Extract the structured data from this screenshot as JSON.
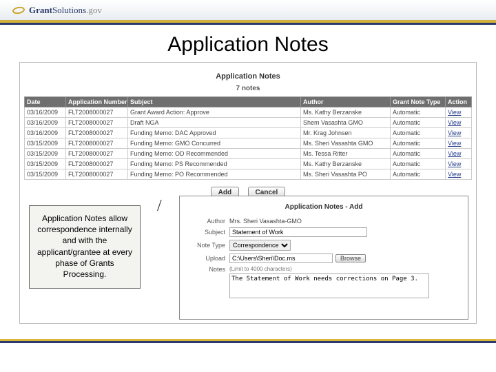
{
  "brand": {
    "name_bold": "Grant",
    "name_rest": "Solutions",
    "suffix": ".gov"
  },
  "slide_title": "Application Notes",
  "panel": {
    "title": "Application Notes",
    "count_label": "7 notes"
  },
  "columns": {
    "date": "Date",
    "appnum": "Application Number",
    "subject": "Subject",
    "author": "Author",
    "type": "Grant Note Type",
    "action": "Action"
  },
  "rows": [
    {
      "date": "03/16/2009",
      "appnum": "FLT2008000027",
      "subject": "Grant Award Action: Approve",
      "author": "Ms. Kathy Berzanske",
      "type": "Automatic",
      "action": "View"
    },
    {
      "date": "03/16/2009",
      "appnum": "FLT2008000027",
      "subject": "Draft NGA",
      "author": "Shem Vasashta GMO",
      "type": "Automatic",
      "action": "View"
    },
    {
      "date": "03/16/2009",
      "appnum": "FLT2008000027",
      "subject": "Funding Memo: DAC Approved",
      "author": "Mr. Krag Johnsen",
      "type": "Automatic",
      "action": "View"
    },
    {
      "date": "03/15/2009",
      "appnum": "FLT2008000027",
      "subject": "Funding Memo: GMO Concurred",
      "author": "Ms. Sheri Vasashta GMO",
      "type": "Automatic",
      "action": "View"
    },
    {
      "date": "03/15/2009",
      "appnum": "FLT2008000027",
      "subject": "Funding Memo: OD Recommended",
      "author": "Ms. Tessa Ritter",
      "type": "Automatic",
      "action": "View"
    },
    {
      "date": "03/15/2009",
      "appnum": "FLT2008000027",
      "subject": "Funding Memo: PS Recommended",
      "author": "Ms. Kathy Berzanske",
      "type": "Automatic",
      "action": "View"
    },
    {
      "date": "03/15/2009",
      "appnum": "FLT2008000027",
      "subject": "Funding Memo: PO Recommended",
      "author": "Ms. Sheri Vasashta PO",
      "type": "Automatic",
      "action": "View"
    }
  ],
  "buttons": {
    "add": "Add",
    "cancel": "Cancel"
  },
  "callout": "Application Notes allow correspondence internally and with the applicant/grantee at every phase of Grants Processing.",
  "add_form": {
    "title": "Application Notes - Add",
    "author_label": "Author",
    "author_value": "Mrs. Sheri Vasashta-GMO",
    "subject_label": "Subject",
    "subject_value": "Statement of Work",
    "type_label": "Note Type",
    "type_value": "Correspondence",
    "upload_label": "Upload",
    "upload_value": "C:\\Users\\Sheri\\Doc.ms",
    "browse": "Browse",
    "notes_label": "Notes",
    "notes_hint": "(Limit to 4000 characters)",
    "notes_value": "The Statement of Work needs corrections on Page 3."
  }
}
